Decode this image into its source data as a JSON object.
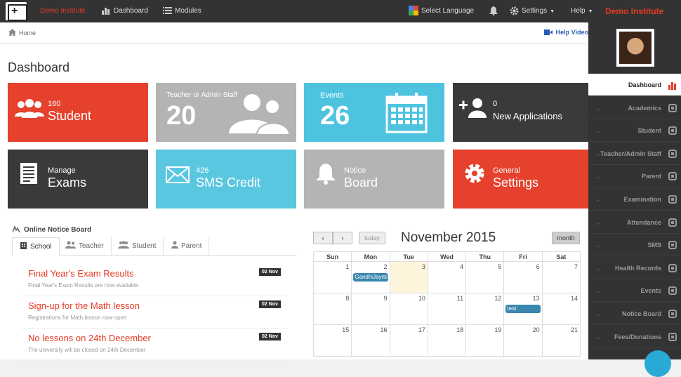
{
  "topbar": {
    "brand": "Demo Institute",
    "nav_dashboard": "Dashboard",
    "nav_modules": "Modules",
    "select_language": "Select Language",
    "settings": "Settings",
    "help": "Help",
    "institute_name": "Demo Institute"
  },
  "breadcrumb": {
    "home": "Home",
    "help_video": "Help Video"
  },
  "page": {
    "title": "Dashboard"
  },
  "tiles": [
    {
      "small": "160",
      "big": "Student",
      "color": "#e5412d"
    },
    {
      "small": "Teacher or Admin Staff",
      "big": "20",
      "color": "#b4b4b4"
    },
    {
      "small": "Events",
      "big": "26",
      "color": "#4dc3e0"
    },
    {
      "small": "0",
      "big": "New Applications",
      "color": "#3a3a3a"
    },
    {
      "small": "Manage",
      "big": "Exams",
      "color": "#3a3a3a"
    },
    {
      "small": "426",
      "big": "SMS Credit",
      "color": "#5ac7e1"
    },
    {
      "small": "Notice",
      "big": "Board",
      "color": "#b4b4b4"
    },
    {
      "small": "General",
      "big": "Settings",
      "color": "#e5412d"
    }
  ],
  "notice_board": {
    "title": "Online Notice Board",
    "tabs": [
      "School",
      "Teacher",
      "Student",
      "Parent"
    ],
    "notices": [
      {
        "title": "Final Year's Exam Results",
        "desc": "Final Year's Exam Results are now available",
        "date": "02 Nov"
      },
      {
        "title": "Sign-up for the Math lesson",
        "desc": "Registrations for Math lesson now open",
        "date": "02 Nov"
      },
      {
        "title": "No lessons on 24th December",
        "desc": "The university will be closed on 24th December",
        "date": "02 Nov"
      }
    ]
  },
  "calendar": {
    "today_label": "today",
    "month_label": "month",
    "title": "November 2015",
    "weekdays": [
      "Sun",
      "Mon",
      "Tue",
      "Wed",
      "Thu",
      "Fri",
      "Sat"
    ],
    "weeks": [
      [
        "1",
        "2",
        "3",
        "4",
        "5",
        "6",
        "7"
      ],
      [
        "8",
        "9",
        "10",
        "11",
        "12",
        "13",
        "14"
      ],
      [
        "15",
        "16",
        "17",
        "18",
        "19",
        "20",
        "21"
      ]
    ],
    "events": {
      "2": "GandhiJaynti",
      "13": "test"
    }
  },
  "sidebar": {
    "items": [
      "Dashboard",
      "Academics",
      "Student",
      "Teacher/Admin Staff",
      "Parent",
      "Examination",
      "Attendance",
      "SMS",
      "Health Records",
      "Events",
      "Notice Board",
      "Fees/Donations"
    ]
  }
}
